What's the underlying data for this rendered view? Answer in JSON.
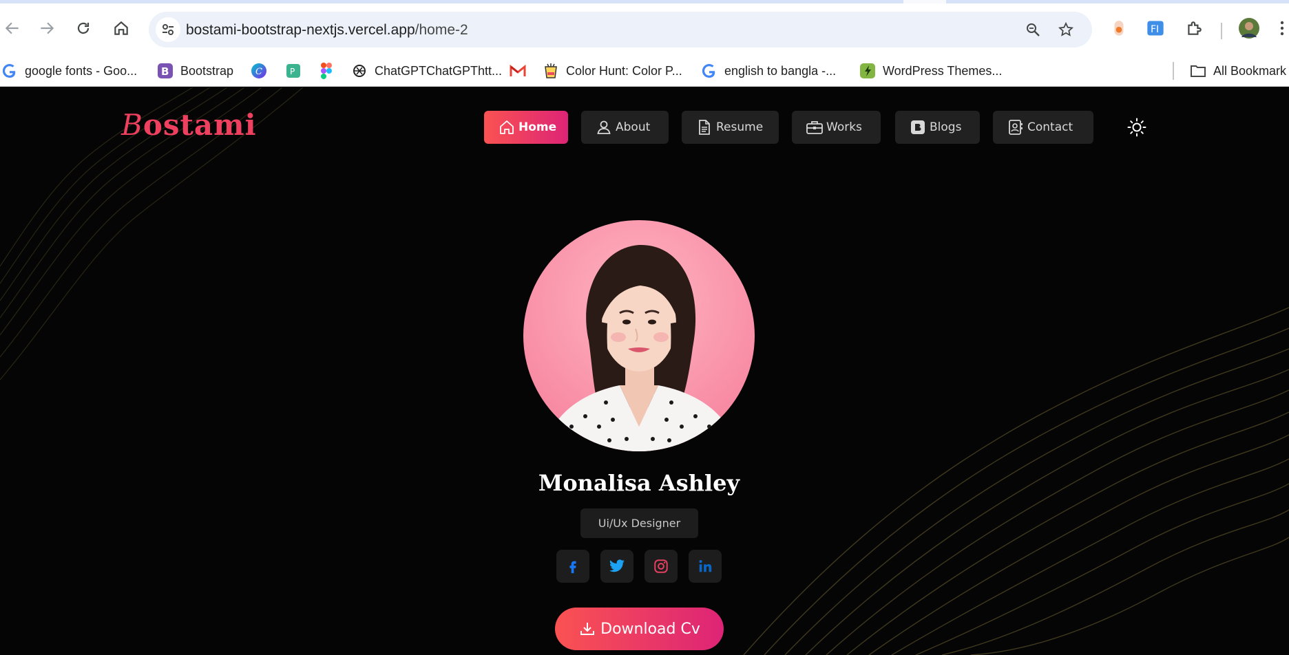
{
  "browser": {
    "url_host": "bostami-bootstrap-nextjs.vercel.app",
    "url_path": "/home-2",
    "bookmarks": [
      {
        "label": "google fonts - Goo...",
        "icon": "google-icon"
      },
      {
        "label": "Bootstrap",
        "icon": "bootstrap-icon"
      },
      {
        "label": "",
        "icon": "canva-icon"
      },
      {
        "label": "",
        "icon": "bookmark-app-icon"
      },
      {
        "label": "",
        "icon": "figma-icon"
      },
      {
        "label": "ChatGPTChatGPThtt...",
        "icon": "chatgpt-icon"
      },
      {
        "label": "",
        "icon": "gmail-icon"
      },
      {
        "label": "Color Hunt: Color P...",
        "icon": "colorhunt-icon"
      },
      {
        "label": "english to bangla -...",
        "icon": "google-icon"
      },
      {
        "label": "WordPress Themes...",
        "icon": "envato-icon"
      }
    ],
    "all_bookmarks_label": "All Bookmark"
  },
  "site": {
    "logo": {
      "first": "B",
      "rest": "ostami"
    },
    "nav": [
      {
        "label": "Home",
        "icon": "home-icon",
        "active": true
      },
      {
        "label": "About",
        "icon": "user-icon",
        "active": false
      },
      {
        "label": "Resume",
        "icon": "document-icon",
        "active": false
      },
      {
        "label": "Works",
        "icon": "briefcase-icon",
        "active": false
      },
      {
        "label": "Blogs",
        "icon": "blog-icon",
        "active": false
      },
      {
        "label": "Contact",
        "icon": "contact-icon",
        "active": false
      }
    ],
    "theme_icon": "sun-icon"
  },
  "profile": {
    "name": "Monalisa Ashley",
    "role": "Ui/Ux Designer",
    "socials": [
      {
        "name": "facebook-icon",
        "color": "#1877f2"
      },
      {
        "name": "twitter-icon",
        "color": "#1da1f2"
      },
      {
        "name": "instagram-icon",
        "color": "#e4405f"
      },
      {
        "name": "linkedin-icon",
        "color": "#0a66c2"
      }
    ],
    "download_label": "Download Cv"
  },
  "colors": {
    "accent_start": "#fa5252",
    "accent_end": "#dd2476",
    "background": "#050505"
  }
}
